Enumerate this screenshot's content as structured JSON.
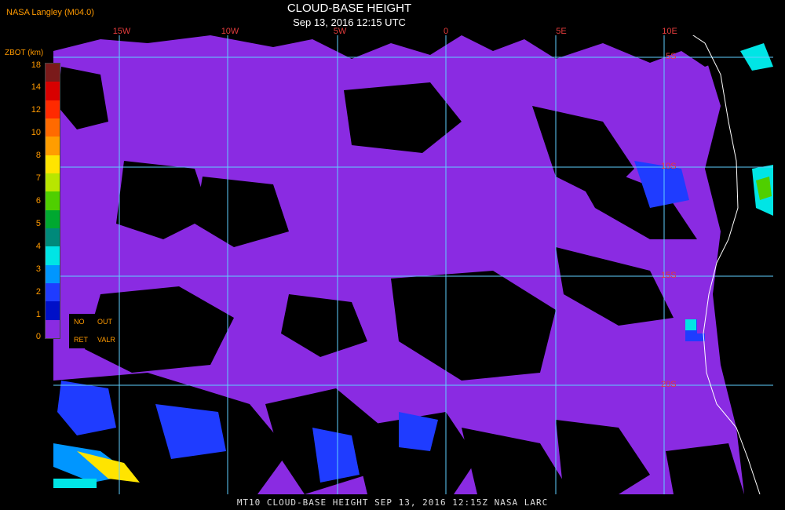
{
  "header": {
    "producer": "NASA Langley (M04.0)",
    "title": "CLOUD-BASE HEIGHT",
    "subtitle": "Sep 13, 2016 12:15 UTC"
  },
  "map": {
    "lon_labels": [
      "15W",
      "10W",
      "5W",
      "0",
      "5E",
      "10E"
    ],
    "lat_labels": [
      "5S",
      "10S",
      "15S",
      "20S"
    ]
  },
  "colorbar": {
    "title": "ZBOT (km)",
    "ticks": [
      "18",
      "14",
      "12",
      "10",
      "8",
      "7",
      "6",
      "5",
      "4",
      "3",
      "2",
      "1",
      "0"
    ],
    "colors": [
      "#7a1a1a",
      "#d80000",
      "#ff2a00",
      "#ff6a00",
      "#ff9d00",
      "#ffe400",
      "#b8e600",
      "#4fcf00",
      "#00a830",
      "#00897a",
      "#00e5e5",
      "#0096ff",
      "#1f3cff",
      "#0010c8",
      "#8a2be2"
    ],
    "no_ret_labels": [
      "NO",
      "OUT",
      "RET",
      "VALR"
    ]
  },
  "footer": "MT10  CLOUD-BASE HEIGHT   SEP 13, 2016 12:15Z   NASA LARC"
}
